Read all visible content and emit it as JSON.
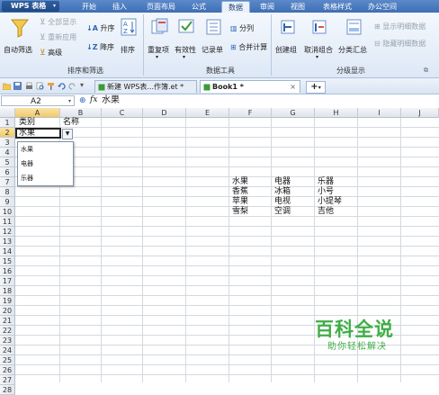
{
  "app": {
    "title": "WPS 表格",
    "menu_arrow": "▾"
  },
  "tabs": [
    "开始",
    "插入",
    "页面布局",
    "公式",
    "数据",
    "审阅",
    "视图",
    "表格样式",
    "办公空间"
  ],
  "active_tab": "数据",
  "ribbon": {
    "filter_group": {
      "autofilter": "自动筛选",
      "show_all": "全部显示",
      "reapply": "重新应用",
      "advanced": "高级",
      "asc": "升序",
      "desc": "降序",
      "sort": "排序",
      "title": "排序和筛选"
    },
    "tools_group": {
      "duplicates": "重复项",
      "validity": "有效性",
      "record_form": "记录单",
      "split_cols": "分列",
      "consolidate": "合并计算",
      "title": "数据工具"
    },
    "outline_group": {
      "create_group": "创建组",
      "ungroup": "取消组合",
      "subtotal": "分类汇总",
      "show_detail": "显示明细数据",
      "hide_detail": "隐藏明细数据",
      "title": "分级显示"
    }
  },
  "doc_tabs": [
    {
      "label": "新建 WPS表...作簿.et *",
      "active": false
    },
    {
      "label": "Book1 *",
      "active": true
    }
  ],
  "new_tab_symbol": "+",
  "formula_bar": {
    "cell_ref": "A2",
    "fx": "fx",
    "value": "水果"
  },
  "columns": [
    "A",
    "B",
    "C",
    "D",
    "E",
    "F",
    "G",
    "H",
    "I",
    "J"
  ],
  "rows": [
    "1",
    "2",
    "3",
    "4",
    "5",
    "6",
    "7",
    "8",
    "9",
    "10",
    "11",
    "12",
    "13",
    "14",
    "15",
    "16",
    "17",
    "18",
    "19",
    "20",
    "21",
    "22",
    "23",
    "24",
    "25",
    "26",
    "27",
    "28"
  ],
  "selected_cell": {
    "col": "A",
    "row": "2"
  },
  "cells": {
    "A1": "类别",
    "B1": "名称",
    "A2": "水果",
    "F6": "水果",
    "G6": "电器",
    "H6": "乐器",
    "F7": "香蕉",
    "G7": "冰箱",
    "H7": "小号",
    "F8": "苹果",
    "G8": "电视",
    "H8": "小提琴",
    "F9": "雪梨",
    "G9": "空调",
    "H9": "吉他"
  },
  "dropdown": {
    "options": [
      "水果",
      "电器",
      "乐器"
    ]
  },
  "watermark": {
    "title": "百科全说",
    "subtitle": "助你轻松解决"
  },
  "colors": {
    "title_bar": "#4a7cc0",
    "header_selected": "#f2c96a",
    "watermark": "#3fae46",
    "grid_line": "#d4d9df"
  }
}
